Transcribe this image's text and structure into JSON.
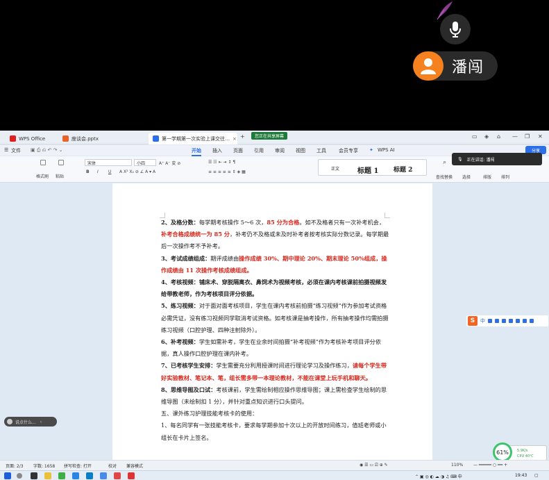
{
  "meeting": {
    "speaker_name": "潘闯",
    "speaker_tip": "正在讲话: 潘闯",
    "share_tag": "您正在共享屏幕",
    "chat_placeholder": "说点什么..."
  },
  "tabs": [
    {
      "label": "WPS Office",
      "color": "#e02020"
    },
    {
      "label": "座谈会.pptx",
      "color": "#e8622a"
    },
    {
      "label": "第一学期第一次实验上课交往…",
      "color": "#2d6fe6"
    }
  ],
  "menubar": {
    "file": "文件",
    "items": [
      "开始",
      "插入",
      "页面",
      "引用",
      "审阅",
      "视图",
      "工具",
      "会员专享"
    ],
    "ai": "WPS AI",
    "share": "分享"
  },
  "ribbon": {
    "format_painter": "格式刷",
    "paste": "粘贴",
    "font_name": "宋体",
    "font_size": "小四",
    "styles": [
      "正文",
      "标题 1",
      "标题 2"
    ],
    "find_replace": "查找替换",
    "select": "选择",
    "layout": "排版",
    "arrange": "排列"
  },
  "document": {
    "paragraphs": [
      [
        {
          "t": "2、及格分数：",
          "s": "b"
        },
        {
          "t": "每学期考核操作 5～6 次，"
        },
        {
          "t": "85 分为合格",
          "s": "red"
        },
        {
          "t": "。如不及格者只有一次补考机会，"
        },
        {
          "t": "补考合格成绩统一为 85 分",
          "s": "red"
        },
        {
          "t": "，补考仍不及格或未及时补考者按考核实际分数记录。每学期最后一次操作考不予补考。"
        }
      ],
      [
        {
          "t": "3、考试成绩组成：",
          "s": "b"
        },
        {
          "t": "期评成绩由"
        },
        {
          "t": "操作成绩 30%、期中理论 20%、期末理论 50%组成，操作成绩由 11 次操作考核成绩组成。",
          "s": "red"
        }
      ],
      [
        {
          "t": "4、考核视频：",
          "s": "b"
        },
        {
          "t": "铺床术、穿脱隔离衣、鼻饲术为视频考核，必须在课内考核课前拍摄视频发给带教老师，作为考核项目评分依据。",
          "s": "b"
        }
      ],
      [
        {
          "t": "5、练习视频：",
          "s": "b"
        },
        {
          "t": "对于面对面考核项目，学生在课内考核前拍摄“练习视频”作为参加考试资格必需凭证，没有练习视频同学取消考试资格。如考核课是抽考操作，所有抽考操作均需拍摄练习视频（口腔护理、四种注射除外）。"
        }
      ],
      [
        {
          "t": "6、补考视频：",
          "s": "b"
        },
        {
          "t": "学生如需补考，学生在业余时间拍摄“补考视频”作为考核补考项目评分依据，真人操作口腔护理在课内补考。"
        }
      ],
      [
        {
          "t": "7、已考核学生安排：",
          "s": "b"
        },
        {
          "t": "学生需要充分利用授课时间进行理论学习及操作练习，"
        },
        {
          "t": "请每个学生带好实验教材、笔记本、笔，组长需多带一本理论教材，不能在课堂上玩手机和聊天。",
          "s": "red"
        }
      ],
      [
        {
          "t": "8、思维导图及口试：",
          "s": "b"
        },
        {
          "t": "考核课前，学生需绘制相应操作思维导图；课上需检查学生绘制的思维导图（未绘制扣 1 分），并针对重点知识进行口头提问。"
        }
      ],
      [
        {
          "t": "五、课外练习护理技能考核卡的使用："
        }
      ],
      [
        {
          "t": "1、每名同学有一张技能考核卡，要求每学期参加十次以上的开放时间练习，值班老师或小组长在卡片上签名。"
        }
      ]
    ]
  },
  "statusbar": {
    "page": "页面: 2/3",
    "words": "字数: 1658",
    "spell": "拼写检查: 打开",
    "proof": "校对",
    "compat": "兼容模式",
    "zoom": "110%"
  },
  "perf": {
    "percent": "61%",
    "net": "5.9K/s",
    "cpu": "CPU 40℃"
  },
  "taskbar": {
    "time": "19:43"
  },
  "colors": {
    "accent": "#2d6fe6",
    "red_text": "#d8281c",
    "speaker_orange": "#f5821f"
  }
}
